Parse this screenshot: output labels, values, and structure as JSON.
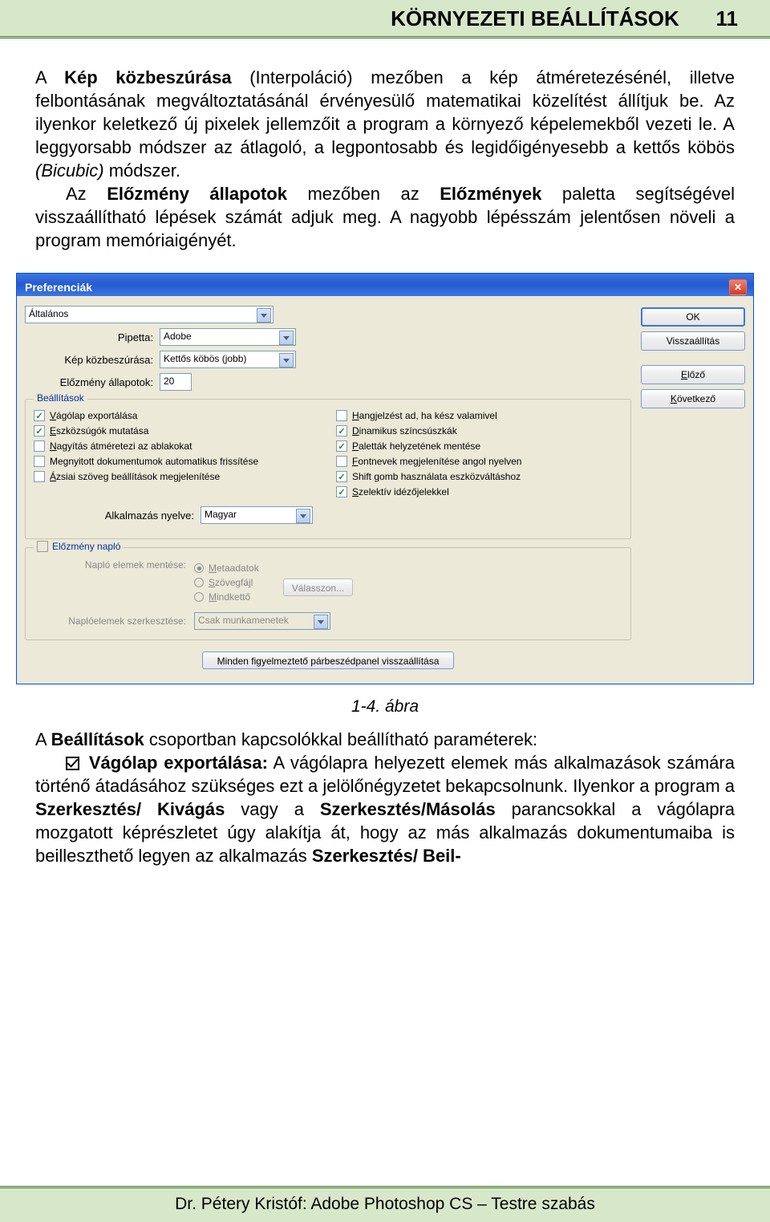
{
  "header": {
    "title": "KÖRNYEZETI BEÁLLÍTÁSOK",
    "page": "11"
  },
  "para1": {
    "pre": "A ",
    "b1": "Kép közbeszúrása",
    "post1": " (Interpoláció) mezőben a kép átméretezésénél, illetve felbontásának megváltoztatásánál érvényesülő matematikai közelítést állítjuk be. Az ilyenkor keletkező új pixelek jellemzőit a program a környező képelemekből vezeti le. A leggyorsabb módszer az átlagoló, a legpontosabb és legidőigényesebb a kettős köbös ",
    "i1": "(Bicubic)",
    "post2": " módszer."
  },
  "para2": {
    "pre": "Az ",
    "b1": "Előzmény állapotok",
    "mid": " mezőben az ",
    "b2": "Előzmények",
    "post": " paletta segítségével visszaállítható lépések számát adjuk meg. A nagyobb lépésszám jelentősen növeli a program memóriaigényét."
  },
  "dlg": {
    "title": "Preferenciák",
    "section": "Általános",
    "pipetta_label": "Pipetta:",
    "pipetta_value": "Adobe",
    "interp_label": "Kép közbeszúrása:",
    "interp_value": "Kettős köbös (jobb)",
    "hist_label": "Előzmény állapotok:",
    "hist_value": "20",
    "group_settings": "Beállítások",
    "left_checks": [
      {
        "checked": true,
        "label": "Vágólap exportálása",
        "key": "V"
      },
      {
        "checked": true,
        "label": "Eszközsúgók mutatása",
        "key": "E"
      },
      {
        "checked": false,
        "label": "Nagyítás átméretezi az ablakokat",
        "key": "N"
      },
      {
        "checked": false,
        "label": "Megnyitott dokumentumok automatikus frissítése",
        "key": ""
      },
      {
        "checked": false,
        "label": "Ázsiai szöveg beállítások megjelenítése",
        "key": "Á"
      }
    ],
    "right_checks": [
      {
        "checked": false,
        "label": "Hangjelzést ad, ha kész valamivel",
        "key": "H"
      },
      {
        "checked": true,
        "label": "Dinamikus színcsúszkák",
        "key": "D"
      },
      {
        "checked": true,
        "label": "Paletták helyzetének mentése",
        "key": "P"
      },
      {
        "checked": false,
        "label": "Fontnevek megjelenítése angol nyelven",
        "key": "F"
      },
      {
        "checked": true,
        "label": "Shift gomb használata eszközváltáshoz",
        "key": ""
      },
      {
        "checked": true,
        "label": "Szelektív idézőjelekkel",
        "key": "S"
      }
    ],
    "lang_label": "Alkalmazás nyelve:",
    "lang_value": "Magyar",
    "group_log": "Előzmény napló",
    "log_save_label": "Napló elemek mentése:",
    "radios": [
      {
        "sel": true,
        "label": "Metaadatok",
        "key": "M"
      },
      {
        "sel": false,
        "label": "Szövegfájl",
        "key": "S"
      },
      {
        "sel": false,
        "label": "Mindkettő",
        "key": "M"
      }
    ],
    "choose_btn": "Válasszon...",
    "log_edit_label": "Naplóelemek szerkesztése:",
    "log_edit_value": "Csak munkamenetek",
    "reset_btn": "Minden figyelmeztető párbeszédpanel visszaállítása",
    "btn_ok": "OK",
    "btn_reset": "Visszaállítás",
    "btn_prev": "Előző",
    "btn_next": "Következő"
  },
  "fig_caption": "1-4. ábra",
  "post1": {
    "pre": "A ",
    "b1": "Beállítások",
    "post": " csoportban kapcsolókkal beállítható paraméterek:"
  },
  "post2": {
    "b1": "Vágólap exportálása:",
    "mid1": " A vágólapra helyezett elemek más alkalmazások számára történő átadásához szükséges ezt a jelölőnégyzetet bekapcsolnunk. Ilyenkor a program a ",
    "b2": "Szerkesztés/ Kivágás",
    "mid2": " vagy a ",
    "b3": "Szerkesztés/Másolás",
    "mid3": " parancsokkal a vágólapra mozgatott képrészletet úgy alakítja át, hogy az más alkalmazás dokumentumaiba is beilleszthető legyen az alkalmazás ",
    "b4": "Szerkesztés/ Beil-"
  },
  "footer": "Dr. Pétery Kristóf: Adobe Photoshop CS – Testre szabás"
}
